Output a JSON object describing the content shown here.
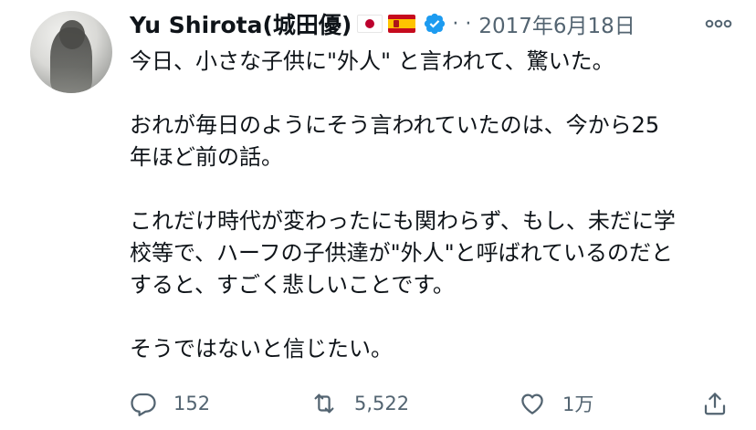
{
  "tweet": {
    "author_name": "Yu Shirota(城田優)",
    "handle_fragment": "·",
    "separator": "·",
    "date": "2017年6月18日",
    "paragraphs": [
      [
        "今日、小さな子供に\"外人\" と言われて、驚いた。"
      ],
      [
        "おれが毎日のようにそう言われていたのは、今から25",
        "年ほど前の話。"
      ],
      [
        "これだけ時代が変わったにも関わらず、もし、未だに学",
        "校等で、ハーフの子供達が\"外人\"と呼ばれているのだと",
        "すると、すごく悲しいことです。"
      ],
      [
        "そうではないと信じたい。"
      ]
    ]
  },
  "actions": {
    "reply_count": "152",
    "retweet_count": "5,522",
    "like_count": "1万"
  },
  "colors": {
    "text": "#0f1419",
    "secondary": "#536471",
    "verified": "#1d9bf0"
  },
  "icons": [
    "verified-badge-icon",
    "more-icon",
    "reply-icon",
    "retweet-icon",
    "like-icon",
    "share-icon",
    "flag-japan-icon",
    "flag-spain-icon"
  ]
}
